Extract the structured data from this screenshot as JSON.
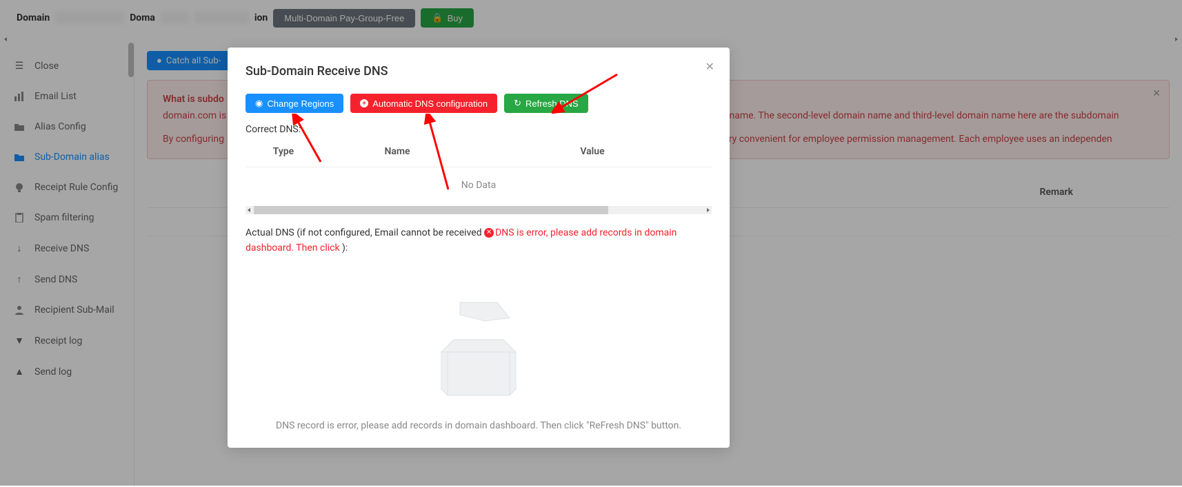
{
  "header": {
    "label_domain": "Domain",
    "label_doma": "Doma",
    "suffix": "ion",
    "multi_domain": "Multi-Domain Pay-Group-Free",
    "buy": "Buy"
  },
  "sidebar": {
    "items": [
      {
        "label": "Close",
        "icon": "close-menu-icon"
      },
      {
        "label": "Email List",
        "icon": "chart-icon"
      },
      {
        "label": "Alias Config",
        "icon": "folder-icon"
      },
      {
        "label": "Sub-Domain alias",
        "icon": "subdomain-icon"
      },
      {
        "label": "Receipt Rule Config",
        "icon": "bulb-icon"
      },
      {
        "label": "Spam filtering",
        "icon": "clipboard-icon"
      },
      {
        "label": "Receive DNS",
        "icon": "download-icon"
      },
      {
        "label": "Send DNS",
        "icon": "upload-icon"
      },
      {
        "label": "Recipient Sub-Mail",
        "icon": "person-icon"
      },
      {
        "label": "Receipt log",
        "icon": "down-triangle-icon"
      },
      {
        "label": "Send log",
        "icon": "up-triangle-icon"
      }
    ]
  },
  "main": {
    "catch_all_btn": "Catch all Sub-",
    "alert": {
      "title": "What is subdo",
      "line1_a": "domain.com is",
      "line1_b": "ain name. The second-level domain name and third-level domain name here are the subdomain",
      "line2_a": "By configuring",
      "line2_b": "s very convenient for employee permission management. Each employee uses an independen"
    },
    "table_header_remark": "Remark"
  },
  "modal": {
    "title": "Sub-Domain Receive DNS",
    "btn_change_regions": "Change Regions",
    "btn_auto_dns": "Automatic DNS configuration",
    "btn_refresh": "Refresh DNS",
    "correct_dns_label": "Correct DNS:",
    "th_type": "Type",
    "th_name": "Name",
    "th_value": "Value",
    "no_data": "No Data",
    "actual_dns_prefix": "Actual DNS (if not configured, Email cannot be received ",
    "actual_dns_error": "DNS is error, please add records in domain dashboard. Then click ",
    "actual_dns_suffix": "):",
    "empty_desc": "DNS record is error, please add records in domain dashboard. Then click \"ReFresh DNS\" button."
  },
  "icons": {
    "lock": "🔒",
    "refresh": "↻",
    "plus": "+",
    "location": "◉",
    "info": "●",
    "x": "✕",
    "close": "✕"
  }
}
